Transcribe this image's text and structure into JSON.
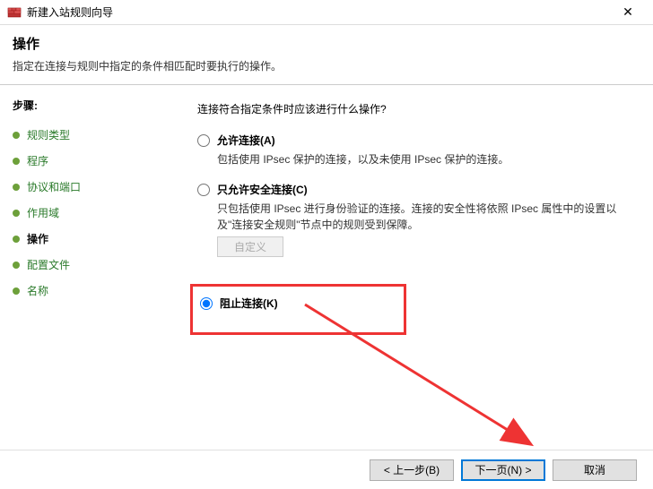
{
  "titlebar": {
    "title": "新建入站规则向导"
  },
  "header": {
    "title": "操作",
    "description": "指定在连接与规则中指定的条件相匹配时要执行的操作。"
  },
  "sidebar": {
    "heading": "步骤:",
    "items": [
      {
        "label": "规则类型"
      },
      {
        "label": "程序"
      },
      {
        "label": "协议和端口"
      },
      {
        "label": "作用域"
      },
      {
        "label": "操作"
      },
      {
        "label": "配置文件"
      },
      {
        "label": "名称"
      }
    ]
  },
  "main": {
    "question": "连接符合指定条件时应该进行什么操作?",
    "options": [
      {
        "title": "允许连接(A)",
        "desc": "包括使用 IPsec 保护的连接，以及未使用 IPsec 保护的连接。"
      },
      {
        "title": "只允许安全连接(C)",
        "desc": "只包括使用 IPsec 进行身份验证的连接。连接的安全性将依照 IPsec 属性中的设置以及\"连接安全规则\"节点中的规则受到保障。"
      },
      {
        "title": "阻止连接(K)",
        "desc": ""
      }
    ],
    "customize_btn": "自定义"
  },
  "footer": {
    "back": "< 上一步(B)",
    "next": "下一页(N) >",
    "cancel": "取消"
  }
}
